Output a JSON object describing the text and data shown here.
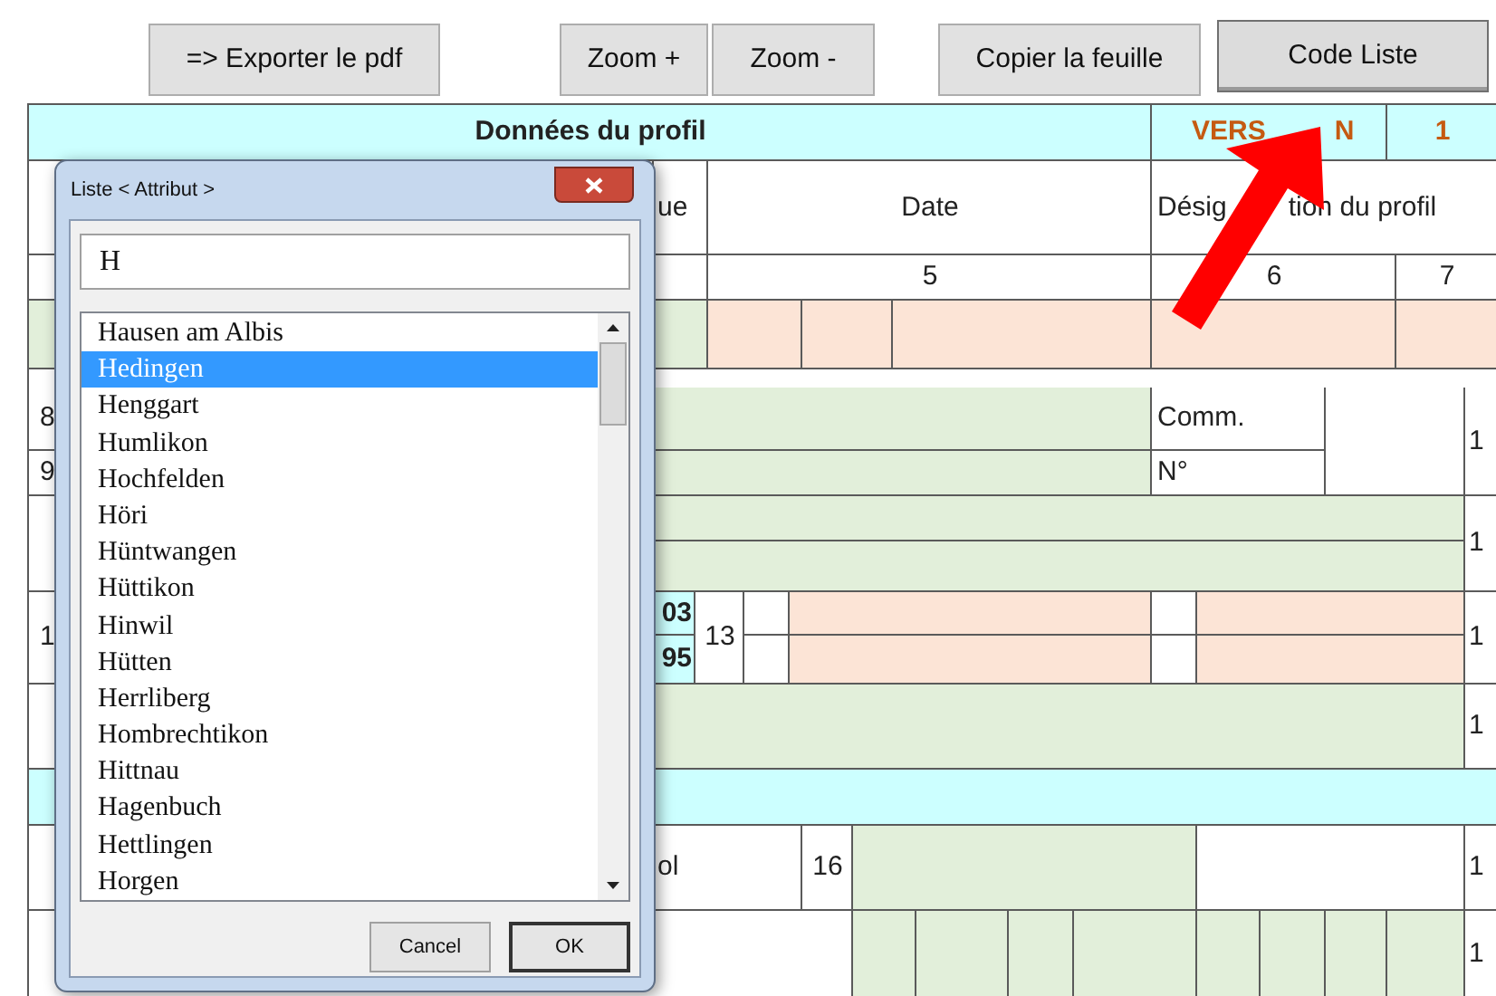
{
  "toolbar": {
    "buttons": [
      {
        "label": "=> Exporter le pdf",
        "pressed": false
      },
      {
        "label": "Zoom +",
        "pressed": false
      },
      {
        "label": "Zoom -",
        "pressed": false
      },
      {
        "label": "Copier la feuille",
        "pressed": false
      },
      {
        "label": "Code Liste",
        "pressed": true
      }
    ]
  },
  "sheet": {
    "title": "Données du profil",
    "version": {
      "label_parts": [
        "VERS",
        "N"
      ],
      "value": "1"
    },
    "header_cells": [
      "ue",
      "Date"
    ],
    "designation_parts": [
      "Désig",
      "tion du profil"
    ],
    "number_cells": [
      "5",
      "6",
      "7"
    ],
    "comm_label": "Comm.",
    "no_label": "N°",
    "left_labels": [
      "8",
      "9",
      "1"
    ],
    "right_labels": [
      "1",
      "1",
      "1",
      "1",
      "1",
      "1"
    ],
    "codes": [
      "03",
      "95"
    ],
    "inline_numbers": [
      "13",
      "16"
    ],
    "partial_label": "ol"
  },
  "dialog": {
    "title": "Liste < Attribut >",
    "search": {
      "value": "H"
    },
    "items": [
      {
        "label": "Hausen am Albis",
        "selected": false
      },
      {
        "label": "Hedingen",
        "selected": true
      },
      {
        "label": "Henggart",
        "selected": false
      },
      {
        "label": "Humlikon",
        "selected": false
      },
      {
        "label": "Hochfelden",
        "selected": false
      },
      {
        "label": "Höri",
        "selected": false
      },
      {
        "label": "Hüntwangen",
        "selected": false
      },
      {
        "label": "Hüttikon",
        "selected": false
      },
      {
        "label": "Hinwil",
        "selected": false
      },
      {
        "label": "Hütten",
        "selected": false
      },
      {
        "label": "Herrliberg",
        "selected": false
      },
      {
        "label": "Hombrechtikon",
        "selected": false
      },
      {
        "label": "Hittnau",
        "selected": false
      },
      {
        "label": "Hagenbuch",
        "selected": false
      },
      {
        "label": "Hettlingen",
        "selected": false
      },
      {
        "label": "Horgen",
        "selected": false
      }
    ],
    "buttons": [
      "Cancel",
      "OK"
    ]
  }
}
